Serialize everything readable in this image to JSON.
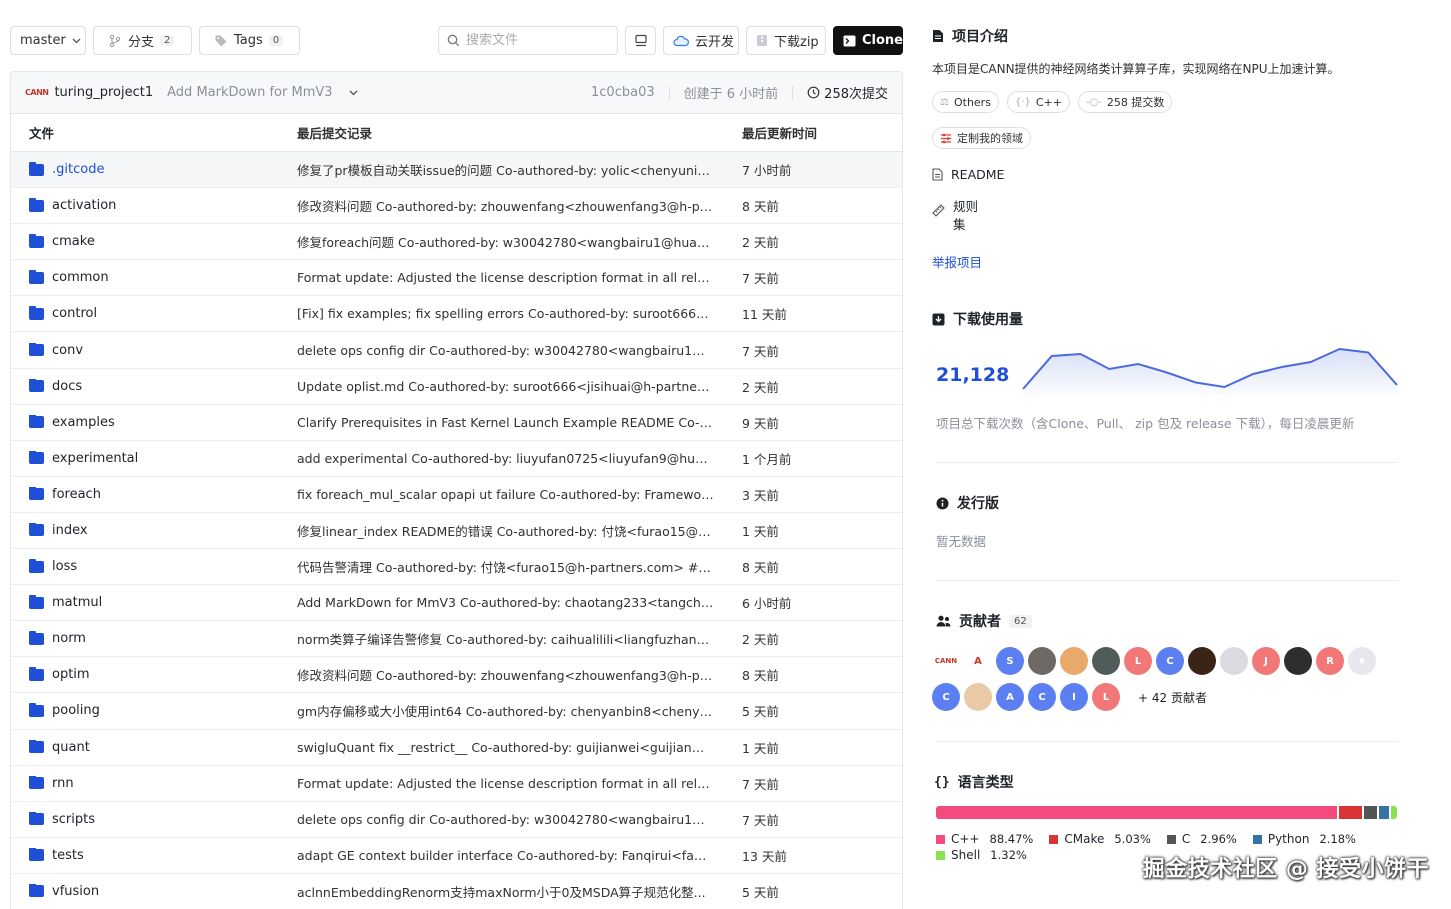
{
  "toolbar": {
    "branch": "master",
    "branches_label": "分支",
    "branches_count": "2",
    "tags_label": "Tags",
    "tags_count": "0",
    "search_placeholder": "搜索文件",
    "cloud_label": "云开发",
    "zip_label": "下载zip",
    "clone_label": "Clone"
  },
  "commit": {
    "logo": "CANN",
    "author": "turing_project1",
    "message": "Add MarkDown for MmV3",
    "hash": "1c0cba03",
    "created": "创建于 6 小时前",
    "total": "258次提交"
  },
  "table": {
    "headers": {
      "file": "文件",
      "commit": "最后提交记录",
      "time": "最后更新时间"
    },
    "rows": [
      {
        "name": ".gitcode",
        "msg": "修复了pr模板自动关联issue的问题 Co-authored-by: yolic<chenyuning...",
        "time": "7 小时前"
      },
      {
        "name": "activation",
        "msg": "修改资料问题 Co-authored-by: zhouwenfang<zhouwenfang3@h-par...",
        "time": "8 天前"
      },
      {
        "name": "cmake",
        "msg": "修复foreach问题 Co-authored-by: w30042780<wangbairu1@huawei...",
        "time": "2 天前"
      },
      {
        "name": "common",
        "msg": "Format update: Adjusted the license description format in all releva...",
        "time": "7 天前"
      },
      {
        "name": "control",
        "msg": "[Fix] fix examples; fix spelling errors Co-authored-by: suroot666<jisi...",
        "time": "11 天前"
      },
      {
        "name": "conv",
        "msg": "delete ops config dir Co-authored-by: w30042780<wangbairu1@hu...",
        "time": "7 天前"
      },
      {
        "name": "docs",
        "msg": "Update oplist.md Co-authored-by: suroot666<jisihuai@h-partners.c...",
        "time": "2 天前"
      },
      {
        "name": "examples",
        "msg": "Clarify Prerequisites in Fast Kernel Launch Example README Co-aut...",
        "time": "9 天前"
      },
      {
        "name": "experimental",
        "msg": "add experimental Co-authored-by: liuyufan0725<liuyufan9@huawe...",
        "time": "1 个月前"
      },
      {
        "name": "foreach",
        "msg": "fix foreach_mul_scalar opapi ut failure Co-authored-by: Framework...",
        "time": "3 天前"
      },
      {
        "name": "index",
        "msg": "修复linear_index README的错误 Co-authored-by: 付饶<furao15@h-...",
        "time": "1 天前"
      },
      {
        "name": "loss",
        "msg": "代码告警清理 Co-authored-by: 付饶<furao15@h-partners.com> # me...",
        "time": "8 天前"
      },
      {
        "name": "matmul",
        "msg": "Add MarkDown for MmV3 Co-authored-by: chaotang233<tangchao4...",
        "time": "6 小时前"
      },
      {
        "name": "norm",
        "msg": "norm类算子编译告警修复 Co-authored-by: caihualilili<liangfuzhan@...",
        "time": "2 天前"
      },
      {
        "name": "optim",
        "msg": "修改资料问题 Co-authored-by: zhouwenfang<zhouwenfang3@h-par...",
        "time": "8 天前"
      },
      {
        "name": "pooling",
        "msg": "gm内存偏移或大小使用int64 Co-authored-by: chenyanbin8<chenya...",
        "time": "5 天前"
      },
      {
        "name": "quant",
        "msg": "swigluQuant fix __restrict__ Co-authored-by: guijianwei<guijianwei...",
        "time": "1 天前"
      },
      {
        "name": "rnn",
        "msg": "Format update: Adjusted the license description format in all releva...",
        "time": "7 天前"
      },
      {
        "name": "scripts",
        "msg": "delete ops config dir Co-authored-by: w30042780<wangbairu1@hu...",
        "time": "7 天前"
      },
      {
        "name": "tests",
        "msg": "adapt GE context builder interface Co-authored-by: Fanqirui<fanqir...",
        "time": "13 天前"
      },
      {
        "name": "vfusion",
        "msg": "aclnnEmbeddingRenorm支持maxNorm小于0及MSDA算子规范化整...",
        "time": "5 天前"
      }
    ]
  },
  "sidebar": {
    "intro_title": "项目介绍",
    "intro_desc": "本项目是CANN提供的神经网络类计算算子库，实现网络在NPU上加速计算。",
    "tags": [
      "Others",
      "C++",
      "258 提交数"
    ],
    "custom_tag": "定制我的领域",
    "readme": "README",
    "rules": "规则集",
    "report": "举报项目",
    "downloads_title": "下载使用量",
    "downloads_count": "21,128",
    "downloads_trend": [
      0.12,
      0.78,
      0.82,
      0.52,
      0.62,
      0.45,
      0.25,
      0.16,
      0.42,
      0.56,
      0.66,
      0.92,
      0.85,
      0.2
    ],
    "downloads_note": "项目总下载次数（含Clone、Pull、 zip 包及 release 下载），每日凌晨更新",
    "release_title": "发行版",
    "release_empty": "暂无数据",
    "contrib_title": "贡献者",
    "contrib_count": "62",
    "contrib_more": "+ 42 贡献者",
    "avatars": [
      {
        "t": "CANN",
        "c": "#ffffff",
        "fg": "#c0392b"
      },
      {
        "t": "A",
        "c": "#ffffff",
        "fg": "#d0342c"
      },
      {
        "t": "S",
        "c": "#5b7ff0",
        "fg": "#ffffff"
      },
      {
        "t": "",
        "c": "#6d6a65",
        "fg": "#ffffff"
      },
      {
        "t": "",
        "c": "#e8a96a",
        "fg": "#ffffff"
      },
      {
        "t": "",
        "c": "#4e5d5a",
        "fg": "#ffffff"
      },
      {
        "t": "L",
        "c": "#f27878",
        "fg": "#ffffff"
      },
      {
        "t": "C",
        "c": "#5b7ff0",
        "fg": "#ffffff"
      },
      {
        "t": "",
        "c": "#3a2418",
        "fg": "#ffffff"
      },
      {
        "t": "",
        "c": "#d9dbe0",
        "fg": "#ffffff"
      },
      {
        "t": "J",
        "c": "#f27878",
        "fg": "#ffffff"
      },
      {
        "t": "",
        "c": "#2e2e2e",
        "fg": "#ffffff"
      },
      {
        "t": "R",
        "c": "#f27878",
        "fg": "#ffffff"
      },
      {
        "t": "★",
        "c": "#e6e8ee",
        "fg": "#ffffff"
      },
      {
        "t": "C",
        "c": "#5b7ff0",
        "fg": "#ffffff"
      },
      {
        "t": "",
        "c": "#e9c9a6",
        "fg": "#ffffff"
      },
      {
        "t": "A",
        "c": "#5b7ff0",
        "fg": "#ffffff"
      },
      {
        "t": "C",
        "c": "#5b7ff0",
        "fg": "#ffffff"
      },
      {
        "t": "I",
        "c": "#5b7ff0",
        "fg": "#ffffff"
      },
      {
        "t": "L",
        "c": "#f27878",
        "fg": "#ffffff"
      }
    ],
    "lang_title": "语言类型",
    "languages": [
      {
        "name": "C++",
        "pct": "88.47%",
        "value": 88.47,
        "color": "#f34b7d"
      },
      {
        "name": "CMake",
        "pct": "5.03%",
        "value": 5.03,
        "color": "#da3434"
      },
      {
        "name": "C",
        "pct": "2.96%",
        "value": 2.96,
        "color": "#555555"
      },
      {
        "name": "Python",
        "pct": "2.18%",
        "value": 2.18,
        "color": "#3572a5"
      },
      {
        "name": "Shell",
        "pct": "1.32%",
        "value": 1.32,
        "color": "#89e051"
      }
    ]
  },
  "watermark": "掘金技术社区 @ 接受小饼干",
  "colors": {
    "accent": "#1f4fd6",
    "clone_bg": "#111111"
  }
}
